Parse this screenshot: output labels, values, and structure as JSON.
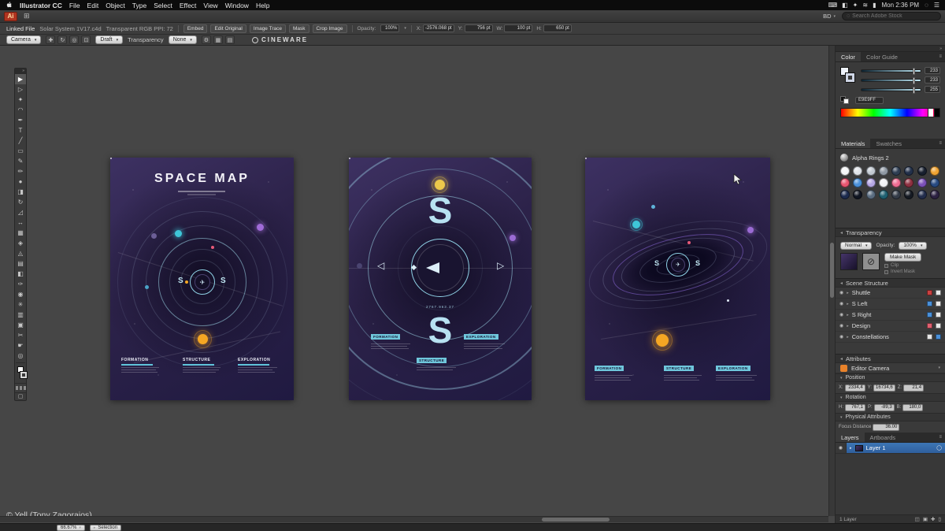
{
  "menubar": {
    "app_name": "Illustrator CC",
    "items": [
      "File",
      "Edit",
      "Object",
      "Type",
      "Select",
      "Effect",
      "View",
      "Window",
      "Help"
    ],
    "status_icons": [
      {
        "name": "keyboard-icon",
        "glyph": "⌨"
      },
      {
        "name": "display-icon",
        "glyph": "◧"
      },
      {
        "name": "sync-icon",
        "glyph": "✦"
      },
      {
        "name": "wifi-icon",
        "glyph": "≋"
      },
      {
        "name": "battery-icon",
        "glyph": "▮"
      }
    ],
    "time": "Mon 2:36 PM",
    "spotlight_glyph": "◌",
    "notification_glyph": "☰"
  },
  "appbar": {
    "logo_text": "Ai",
    "grid_glyph": "⊞",
    "workspace_label": "BD",
    "workspace_caret": "▾",
    "search_glyph": "◌",
    "search_placeholder": "Search Adobe Stock"
  },
  "controlbar": {
    "type_label": "Linked File",
    "filename": "Solar System 1V17.c4d",
    "file_info": "Transparent RGB PPI: 72",
    "buttons": [
      "Embed",
      "Edit Original",
      "Image Trace",
      "Mask",
      "Crop Image"
    ],
    "opacity_label": "Opacity:",
    "opacity_value": "100%",
    "fields": [
      {
        "label": "X:",
        "value": "-2576.068 pt"
      },
      {
        "label": "Y:",
        "value": "756 pt"
      },
      {
        "label": "W:",
        "value": "100 pt"
      },
      {
        "label": "H:",
        "value": "650 pt"
      }
    ]
  },
  "cineware": {
    "camera_select": "Camera",
    "icons": [
      "✚",
      "↻",
      "◎",
      "⊡"
    ],
    "render_select": "Draft",
    "transparency_label": "Transparency",
    "transparency_select": "None",
    "extra_icons": [
      "⚙",
      "▦",
      "▤"
    ],
    "brand": "CINEWARE"
  },
  "tools": [
    {
      "name": "selection-tool",
      "glyph": "▶"
    },
    {
      "name": "direct-selection-tool",
      "glyph": "▷"
    },
    {
      "name": "magic-wand-tool",
      "glyph": "✦"
    },
    {
      "name": "lasso-tool",
      "glyph": "◠"
    },
    {
      "name": "pen-tool",
      "glyph": "✒"
    },
    {
      "name": "type-tool",
      "glyph": "T"
    },
    {
      "name": "line-segment-tool",
      "glyph": "╱"
    },
    {
      "name": "rectangle-tool",
      "glyph": "▭"
    },
    {
      "name": "paintbrush-tool",
      "glyph": "✎"
    },
    {
      "name": "pencil-tool",
      "glyph": "✏"
    },
    {
      "name": "blob-brush-tool",
      "glyph": "●"
    },
    {
      "name": "eraser-tool",
      "glyph": "◨"
    },
    {
      "name": "rotate-tool",
      "glyph": "↻"
    },
    {
      "name": "scale-tool",
      "glyph": "◿"
    },
    {
      "name": "width-tool",
      "glyph": "↔"
    },
    {
      "name": "free-transform-tool",
      "glyph": "▦"
    },
    {
      "name": "shape-builder-tool",
      "glyph": "◈"
    },
    {
      "name": "perspective-grid-tool",
      "glyph": "◬"
    },
    {
      "name": "mesh-tool",
      "glyph": "▤"
    },
    {
      "name": "gradient-tool",
      "glyph": "◧"
    },
    {
      "name": "eyedropper-tool",
      "glyph": "✑"
    },
    {
      "name": "blend-tool",
      "glyph": "◉"
    },
    {
      "name": "symbol-sprayer-tool",
      "glyph": "✳"
    },
    {
      "name": "column-graph-tool",
      "glyph": "▥"
    },
    {
      "name": "artboard-tool",
      "glyph": "▣"
    },
    {
      "name": "slice-tool",
      "glyph": "✂"
    },
    {
      "name": "hand-tool",
      "glyph": "☛"
    },
    {
      "name": "zoom-tool",
      "glyph": "◎"
    }
  ],
  "canvas": {
    "caption": "© Yell (Tony Zagoraios)",
    "posters": [
      {
        "title": "SPACE MAP",
        "center_left": "S",
        "center_right": "S",
        "sections": [
          "FORMATION",
          "STRUCTURE",
          "EXPLORATION"
        ]
      },
      {
        "letter_top": "S",
        "letter_bottom": "S",
        "left_arrow": "◁",
        "right_arrow": "▷",
        "center_value": "2767.963.37",
        "sections": [
          "FORMATION",
          "EXPLORATION",
          "STRUCTURE"
        ]
      },
      {
        "center_left": "S",
        "center_right": "S",
        "sections": [
          "FORMATION",
          "STRUCTURE",
          "EXPLORATION"
        ]
      }
    ]
  },
  "panels": {
    "color": {
      "tabs": [
        "Color",
        "Color Guide"
      ],
      "sliders": [
        {
          "value": "233"
        },
        {
          "value": "233"
        },
        {
          "value": "255"
        }
      ],
      "hex": "E9E9FF"
    },
    "materials": {
      "tabs": [
        "Materials",
        "Swatches"
      ],
      "item_label": "Alpha Rings 2",
      "swatches": [
        "#f5f6f8",
        "#dfe3e8",
        "#c2c9d1",
        "#8f98a3",
        "#2e3d52",
        "#22304a",
        "#171f2e",
        "#f0a433",
        "#e85570",
        "#4a90d9",
        "#b5a6e3",
        "#f2f2f4",
        "#ef6d92",
        "#8e3040",
        "#7b51b8",
        "#274a80",
        "#1c2b4e",
        "#101522",
        "#5a6c80",
        "#1f6070",
        "#343c48",
        "#151a23",
        "#222d4c",
        "#2c2142"
      ]
    },
    "transparency": {
      "title": "Transparency",
      "blend_mode": "Normal",
      "opacity_label": "Opacity:",
      "opacity_value": "100%",
      "make_mask_label": "Make Mask",
      "clip_label": "Clip",
      "invert_label": "Invert Mask"
    },
    "scene": {
      "title": "Scene Structure",
      "rows": [
        {
          "label": "Shuttle",
          "chips": [
            "#c94040",
            "#e8e8e8"
          ]
        },
        {
          "label": "S Left",
          "chips": [
            "#4a90d9",
            "#e8e8e8"
          ]
        },
        {
          "label": "S Right",
          "chips": [
            "#4a90d9",
            "#e8e8e8"
          ]
        },
        {
          "label": "Design",
          "chips": [
            "#e06070",
            "#e8e8e8"
          ]
        },
        {
          "label": "Constellations",
          "chips": [
            "#e8e8e8",
            "#4a90d9"
          ]
        }
      ]
    },
    "attributes": {
      "title": "Attributes",
      "camera_label": "Editor Camera",
      "position": {
        "label": "Position",
        "fields": [
          {
            "label": "X:",
            "value": "2334,4"
          },
          {
            "label": "Y:",
            "value": "16734,6"
          },
          {
            "label": "Z:",
            "value": "21,4"
          }
        ]
      },
      "rotation": {
        "label": "Rotation",
        "fields": [
          {
            "label": "H:",
            "value": "767,1"
          },
          {
            "label": "P:",
            "value": "-89,3"
          },
          {
            "label": "B:",
            "value": "180,0"
          }
        ]
      },
      "physical": {
        "label": "Physical Attributes",
        "focus_label": "Focus Distance",
        "focus_value": "36.00"
      }
    },
    "layers": {
      "tabs": [
        "Layers",
        "Artboards"
      ],
      "layer_name": "Layer 1",
      "count_label": "1 Layer",
      "footer_icons": [
        {
          "name": "make-mask-icon",
          "glyph": "◫"
        },
        {
          "name": "new-sublayer-icon",
          "glyph": "▣"
        },
        {
          "name": "new-layer-icon",
          "glyph": "✚"
        },
        {
          "name": "delete-layer-icon",
          "glyph": "▯"
        }
      ]
    }
  },
  "statusbar": {
    "zoom": "66.67%",
    "tool": "Selection"
  }
}
